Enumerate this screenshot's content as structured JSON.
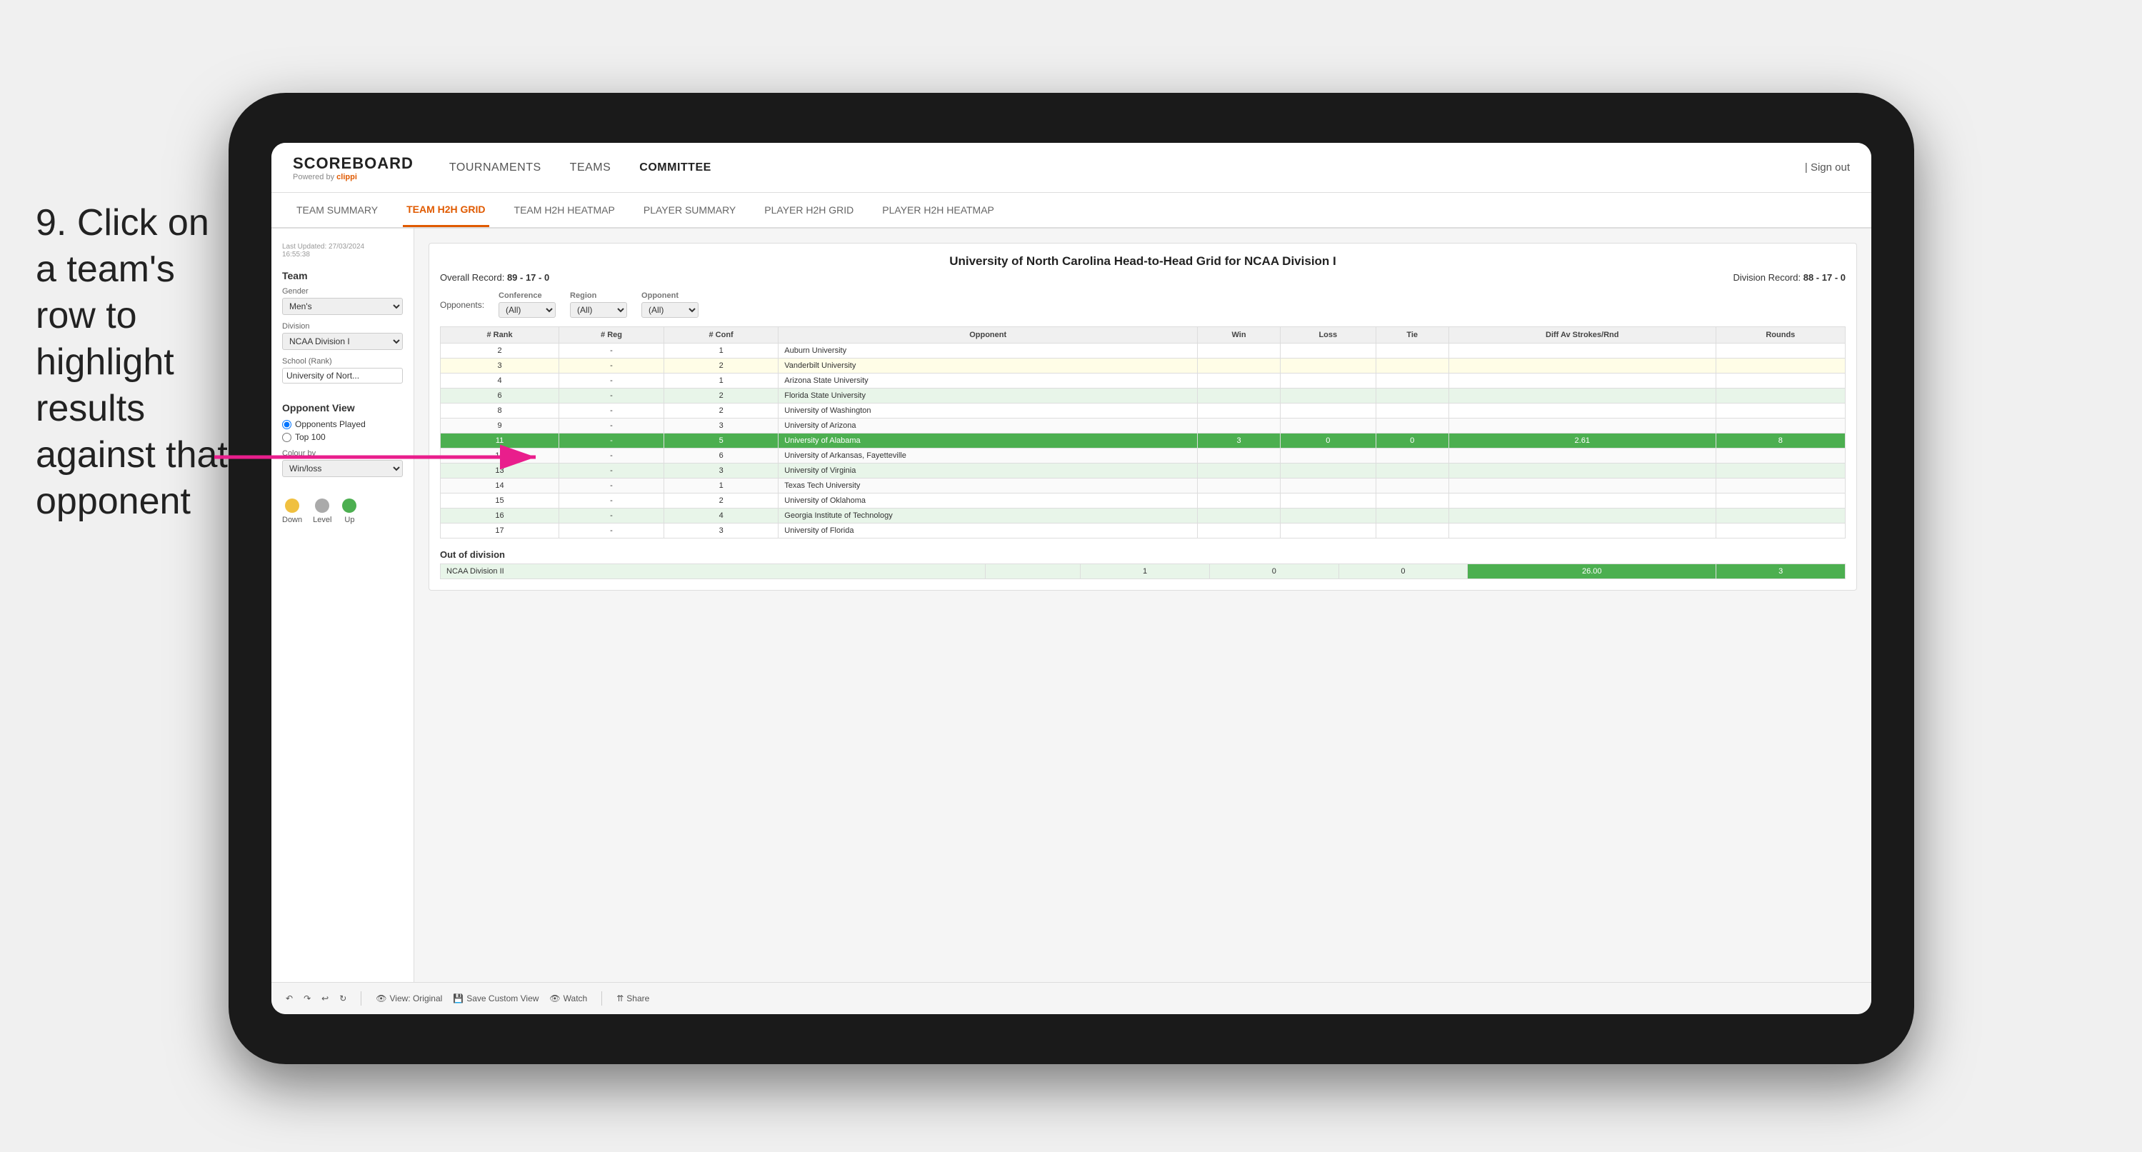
{
  "instruction": {
    "step": "9.",
    "text": "Click on a team's row to highlight results against that opponent"
  },
  "nav": {
    "logo": "SCOREBOARD",
    "powered_by": "Powered by",
    "powered_brand": "clippi",
    "links": [
      "TOURNAMENTS",
      "TEAMS",
      "COMMITTEE"
    ],
    "sign_out": "Sign out"
  },
  "sub_nav": {
    "links": [
      "TEAM SUMMARY",
      "TEAM H2H GRID",
      "TEAM H2H HEATMAP",
      "PLAYER SUMMARY",
      "PLAYER H2H GRID",
      "PLAYER H2H HEATMAP"
    ],
    "active": "TEAM H2H GRID"
  },
  "sidebar": {
    "last_updated_label": "Last Updated: 27/03/2024",
    "last_updated_time": "16:55:38",
    "team_label": "Team",
    "gender_label": "Gender",
    "gender_value": "Men's",
    "division_label": "Division",
    "division_value": "NCAA Division I",
    "school_label": "School (Rank)",
    "school_value": "University of Nort...",
    "opponent_view_label": "Opponent View",
    "opponent_options": [
      "Opponents Played",
      "Top 100"
    ],
    "opponent_selected": "Opponents Played",
    "colour_by_label": "Colour by",
    "colour_by_value": "Win/loss",
    "legend": {
      "down_label": "Down",
      "level_label": "Level",
      "up_label": "Up"
    }
  },
  "grid": {
    "title": "University of North Carolina Head-to-Head Grid for NCAA Division I",
    "overall_record_label": "Overall Record:",
    "overall_record": "89 - 17 - 0",
    "division_record_label": "Division Record:",
    "division_record": "88 - 17 - 0",
    "filters": {
      "conference_label": "Conference",
      "conference_value": "(All)",
      "region_label": "Region",
      "region_value": "(All)",
      "opponent_label": "Opponent",
      "opponent_value": "(All)",
      "opponents_label": "Opponents:"
    },
    "columns": [
      "# Rank",
      "# Reg",
      "# Conf",
      "Opponent",
      "Win",
      "Loss",
      "Tie",
      "Diff Av Strokes/Rnd",
      "Rounds"
    ],
    "rows": [
      {
        "rank": "2",
        "reg": "-",
        "conf": "1",
        "opponent": "Auburn University",
        "win": "",
        "loss": "",
        "tie": "",
        "diff": "",
        "rounds": "",
        "style": "normal"
      },
      {
        "rank": "3",
        "reg": "-",
        "conf": "2",
        "opponent": "Vanderbilt University",
        "win": "",
        "loss": "",
        "tie": "",
        "diff": "",
        "rounds": "",
        "style": "light-yellow"
      },
      {
        "rank": "4",
        "reg": "-",
        "conf": "1",
        "opponent": "Arizona State University",
        "win": "",
        "loss": "",
        "tie": "",
        "diff": "",
        "rounds": "",
        "style": "normal"
      },
      {
        "rank": "6",
        "reg": "-",
        "conf": "2",
        "opponent": "Florida State University",
        "win": "",
        "loss": "",
        "tie": "",
        "diff": "",
        "rounds": "",
        "style": "light-green"
      },
      {
        "rank": "8",
        "reg": "-",
        "conf": "2",
        "opponent": "University of Washington",
        "win": "",
        "loss": "",
        "tie": "",
        "diff": "",
        "rounds": "",
        "style": "normal"
      },
      {
        "rank": "9",
        "reg": "-",
        "conf": "3",
        "opponent": "University of Arizona",
        "win": "",
        "loss": "",
        "tie": "",
        "diff": "",
        "rounds": "",
        "style": "normal"
      },
      {
        "rank": "11",
        "reg": "-",
        "conf": "5",
        "opponent": "University of Alabama",
        "win": "3",
        "loss": "0",
        "tie": "0",
        "diff": "2.61",
        "rounds": "8",
        "style": "highlighted"
      },
      {
        "rank": "12",
        "reg": "-",
        "conf": "6",
        "opponent": "University of Arkansas, Fayetteville",
        "win": "",
        "loss": "",
        "tie": "",
        "diff": "",
        "rounds": "",
        "style": "normal"
      },
      {
        "rank": "13",
        "reg": "-",
        "conf": "3",
        "opponent": "University of Virginia",
        "win": "",
        "loss": "",
        "tie": "",
        "diff": "",
        "rounds": "",
        "style": "light-green"
      },
      {
        "rank": "14",
        "reg": "-",
        "conf": "1",
        "opponent": "Texas Tech University",
        "win": "",
        "loss": "",
        "tie": "",
        "diff": "",
        "rounds": "",
        "style": "normal"
      },
      {
        "rank": "15",
        "reg": "-",
        "conf": "2",
        "opponent": "University of Oklahoma",
        "win": "",
        "loss": "",
        "tie": "",
        "diff": "",
        "rounds": "",
        "style": "normal"
      },
      {
        "rank": "16",
        "reg": "-",
        "conf": "4",
        "opponent": "Georgia Institute of Technology",
        "win": "",
        "loss": "",
        "tie": "",
        "diff": "",
        "rounds": "",
        "style": "light-green"
      },
      {
        "rank": "17",
        "reg": "-",
        "conf": "3",
        "opponent": "University of Florida",
        "win": "",
        "loss": "",
        "tie": "",
        "diff": "",
        "rounds": "",
        "style": "normal"
      }
    ],
    "out_of_division_label": "Out of division",
    "out_of_division_row": {
      "name": "NCAA Division II",
      "win": "1",
      "loss": "0",
      "tie": "0",
      "diff": "26.00",
      "rounds": "3"
    }
  },
  "toolbar": {
    "view_label": "View: Original",
    "save_custom_label": "Save Custom View",
    "watch_label": "Watch",
    "share_label": "Share"
  },
  "colors": {
    "accent": "#e05a00",
    "highlighted_row": "#4CAF50",
    "light_green_row": "#e8f5e9",
    "light_yellow_row": "#fffde7",
    "out_div_green": "#4CAF50",
    "legend_down": "#f0c040",
    "legend_level": "#aaaaaa",
    "legend_up": "#4CAF50"
  }
}
